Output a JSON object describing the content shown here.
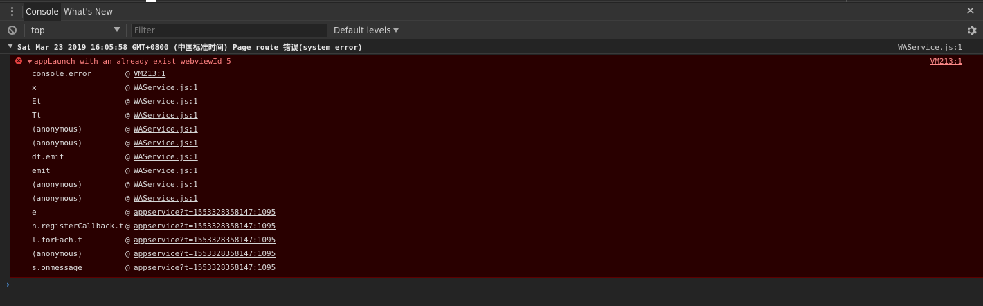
{
  "tabs": {
    "console": "Console",
    "whats_new": "What's New"
  },
  "toolbar": {
    "context": "top",
    "filter_placeholder": "Filter",
    "levels": "Default levels"
  },
  "group": {
    "title": "Sat Mar 23 2019 16:05:58 GMT+0800 (中国标准时间) Page route 错误(system error)",
    "source": "WAService.js:1"
  },
  "error": {
    "message": "appLaunch with an already exist webviewId 5",
    "source": "VM213:1",
    "frames": [
      {
        "fn": "console.error",
        "loc": "VM213:1"
      },
      {
        "fn": "x",
        "loc": "WAService.js:1"
      },
      {
        "fn": "Et",
        "loc": "WAService.js:1"
      },
      {
        "fn": "Tt",
        "loc": "WAService.js:1"
      },
      {
        "fn": "(anonymous)",
        "loc": "WAService.js:1"
      },
      {
        "fn": "(anonymous)",
        "loc": "WAService.js:1"
      },
      {
        "fn": "dt.emit",
        "loc": "WAService.js:1"
      },
      {
        "fn": "emit",
        "loc": "WAService.js:1"
      },
      {
        "fn": "(anonymous)",
        "loc": "WAService.js:1"
      },
      {
        "fn": "(anonymous)",
        "loc": "WAService.js:1"
      },
      {
        "fn": "e",
        "loc": "appservice?t=1553328358147:1095"
      },
      {
        "fn": "n.registerCallback.t",
        "loc": "appservice?t=1553328358147:1095"
      },
      {
        "fn": "l.forEach.t",
        "loc": "appservice?t=1553328358147:1095"
      },
      {
        "fn": "(anonymous)",
        "loc": "appservice?t=1553328358147:1095"
      },
      {
        "fn": "s.onmessage",
        "loc": "appservice?t=1553328358147:1095"
      }
    ]
  },
  "at_symbol": "@",
  "colors": {
    "error_bg": "#290000",
    "error_text": "#ff8080",
    "panel_bg": "#242424",
    "toolbar_bg": "#333333",
    "prompt_accent": "#4c8fd6"
  }
}
